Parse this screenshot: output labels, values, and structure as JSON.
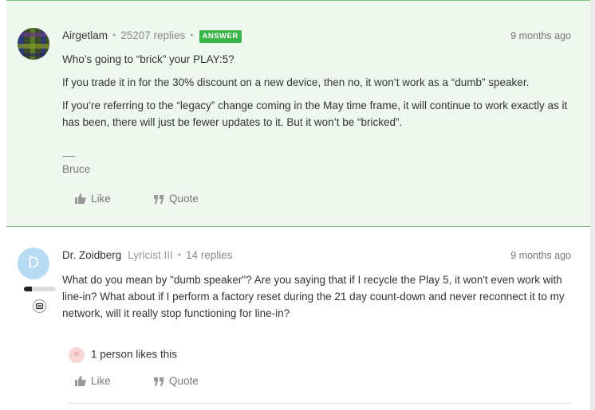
{
  "post1": {
    "author": "Airgetlam",
    "replies": "25207 replies",
    "badge": "ANSWER",
    "time": "9 months ago",
    "paragraphs": [
      "Who’s going to “brick” your PLAY:5?",
      "If you trade it in for the 30% discount on a new device, then no, it won’t work as a “dumb” speaker.",
      "If you’re referring to the “legacy” change coming in the May time frame, it will continue to work exactly as it has been, there will just be fewer updates to it. But it won’t be “bricked”."
    ],
    "signature": "Bruce",
    "like_label": "Like",
    "quote_label": "Quote"
  },
  "post2": {
    "author": "Dr. Zoidberg",
    "rank": "Lyricist III",
    "replies": "14 replies",
    "time": "9 months ago",
    "avatar_letter": "D",
    "rank_progress": 0.25,
    "body": "What do you mean by \"dumb speaker\"? Are you saying that if I recycle the Play 5, it won't even work with line-in? What about if I perform a factory reset during the 21 day count-down and never reconnect it to my network, will it really stop functioning for line-in?",
    "likes_avatar_letter": "W",
    "likes_text": "1 person likes this",
    "like_label": "Like",
    "quote_label": "Quote"
  },
  "colors": {
    "answer_bg": "#eff8ee",
    "answer_border": "#7bbf72",
    "badge": "#3ab54a",
    "avatar_d": "#b8daf2"
  },
  "icons": [
    "thumbs-up-icon",
    "quote-icon",
    "rank-badge-icon"
  ]
}
